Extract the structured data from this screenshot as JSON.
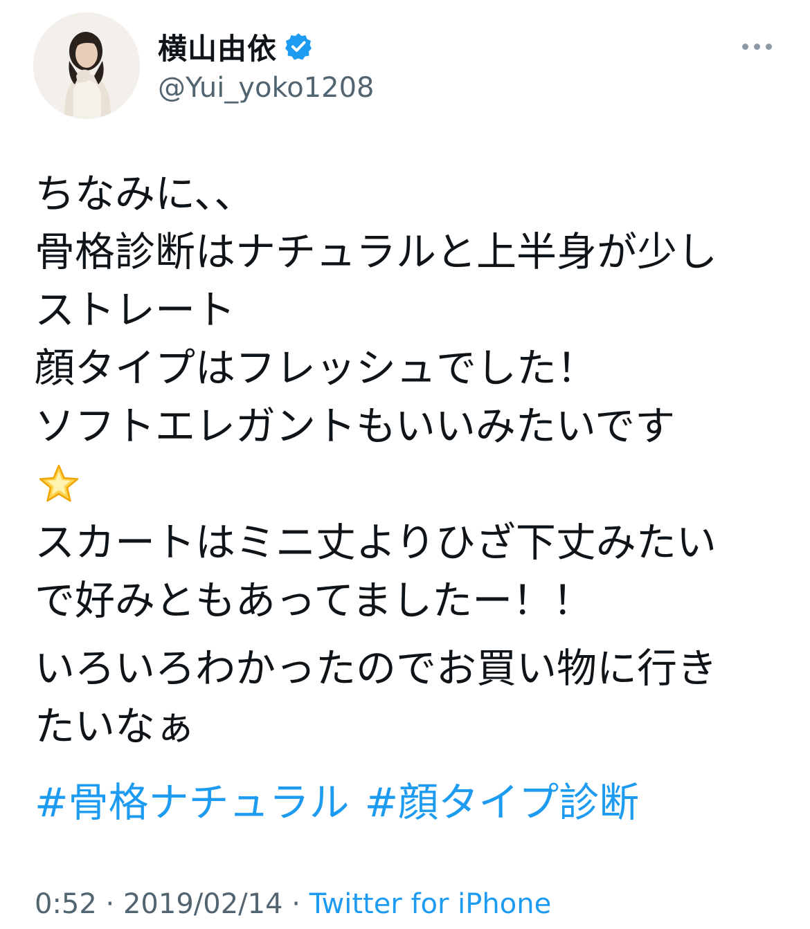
{
  "author": {
    "display_name": "横山由依",
    "handle": "@Yui_yoko1208",
    "verified": true
  },
  "tweet": {
    "lines": [
      "ちなみに、、",
      "骨格診断はナチュラルと上半身が少し",
      "ストレート",
      "顔タイプはフレッシュでした！",
      "ソフトエレガントもいいみたいです",
      "スカートはミニ丈よりひざ下丈みたい",
      "で好みともあってましたー！！",
      "いろいろわかったのでお買い物に行き",
      "たいなぁ"
    ],
    "emoji": "glowing-star",
    "hashtags": [
      "#骨格ナチュラル",
      "#顔タイプ診断"
    ]
  },
  "meta": {
    "time": "0:52",
    "separator": "·",
    "date": "2019/02/14",
    "source": "Twitter for iPhone"
  },
  "colors": {
    "link": "#1d9bf0",
    "verified": "#1d9bf0",
    "secondary_text": "#536471",
    "text": "#0f1419"
  },
  "icons": {
    "verified": "verified-badge-icon",
    "more": "more-options-icon",
    "emoji": "glowing-star-emoji-icon"
  }
}
